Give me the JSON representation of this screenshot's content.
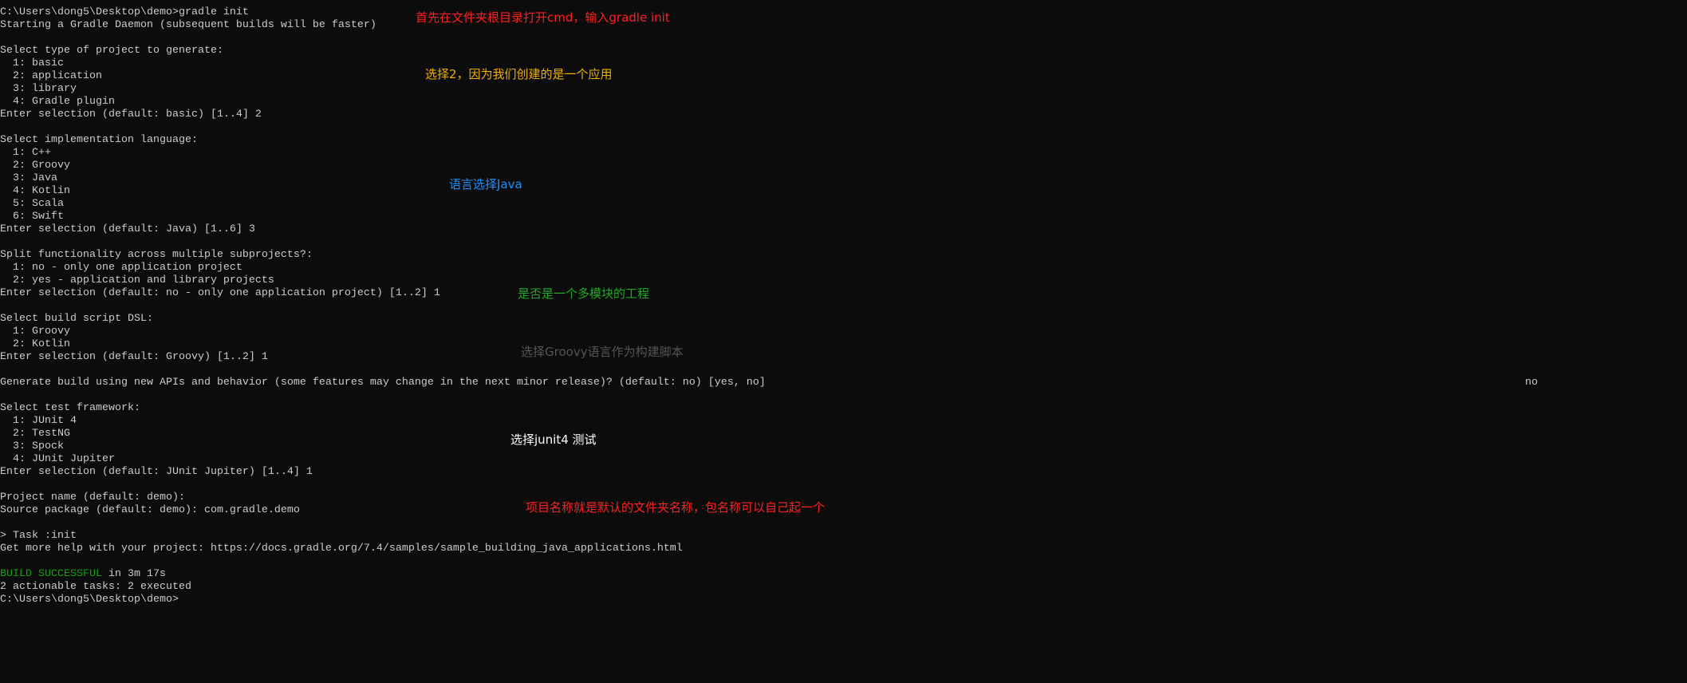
{
  "terminal": {
    "text_color": "#cccccc",
    "background": "#0c0c0c",
    "success_color": "#13a10e",
    "lines": [
      "C:\\Users\\dong5\\Desktop\\demo>gradle init",
      "Starting a Gradle Daemon (subsequent builds will be faster)",
      "",
      "Select type of project to generate:",
      "  1: basic",
      "  2: application",
      "  3: library",
      "  4: Gradle plugin",
      "Enter selection (default: basic) [1..4] 2",
      "",
      "Select implementation language:",
      "  1: C++",
      "  2: Groovy",
      "  3: Java",
      "  4: Kotlin",
      "  5: Scala",
      "  6: Swift",
      "Enter selection (default: Java) [1..6] 3",
      "",
      "Split functionality across multiple subprojects?:",
      "  1: no - only one application project",
      "  2: yes - application and library projects",
      "Enter selection (default: no - only one application project) [1..2] 1",
      "",
      "Select build script DSL:",
      "  1: Groovy",
      "  2: Kotlin",
      "Enter selection (default: Groovy) [1..2] 1",
      "",
      "Generate build using new APIs and behavior (some features may change in the next minor release)? (default: no) [yes, no]",
      "",
      "Select test framework:",
      "  1: JUnit 4",
      "  2: TestNG",
      "  3: Spock",
      "  4: JUnit Jupiter",
      "Enter selection (default: JUnit Jupiter) [1..4] 1",
      "",
      "Project name (default: demo):",
      "Source package (default: demo): com.gradle.demo",
      "",
      "> Task :init",
      "Get more help with your project: https://docs.gradle.org/7.4/samples/sample_building_java_applications.html",
      "",
      {
        "status": "BUILD SUCCESSFUL",
        "rest": " in 3m 17s"
      },
      "2 actionable tasks: 2 executed",
      "C:\\Users\\dong5\\Desktop\\demo>"
    ],
    "new_api_answer": "no"
  },
  "annotations": [
    {
      "text": "首先在文件夹根目录打开cmd，输入gradle init",
      "color": "#ff2020"
    },
    {
      "text": "选择2，因为我们创建的是一个应用",
      "color": "#f0b000"
    },
    {
      "text": "语言选择Java",
      "color": "#1e90ff"
    },
    {
      "text": "是否是一个多模块的工程",
      "color": "#22a822"
    },
    {
      "text": "选择Groovy语言作为构建脚本",
      "color": "#555555"
    },
    {
      "text": "选择junit4 测试",
      "color": "#ffffff"
    },
    {
      "text": "项目名称就是默认的文件夹名称，包名称可以自己起一个",
      "color": "#ff2020"
    }
  ]
}
